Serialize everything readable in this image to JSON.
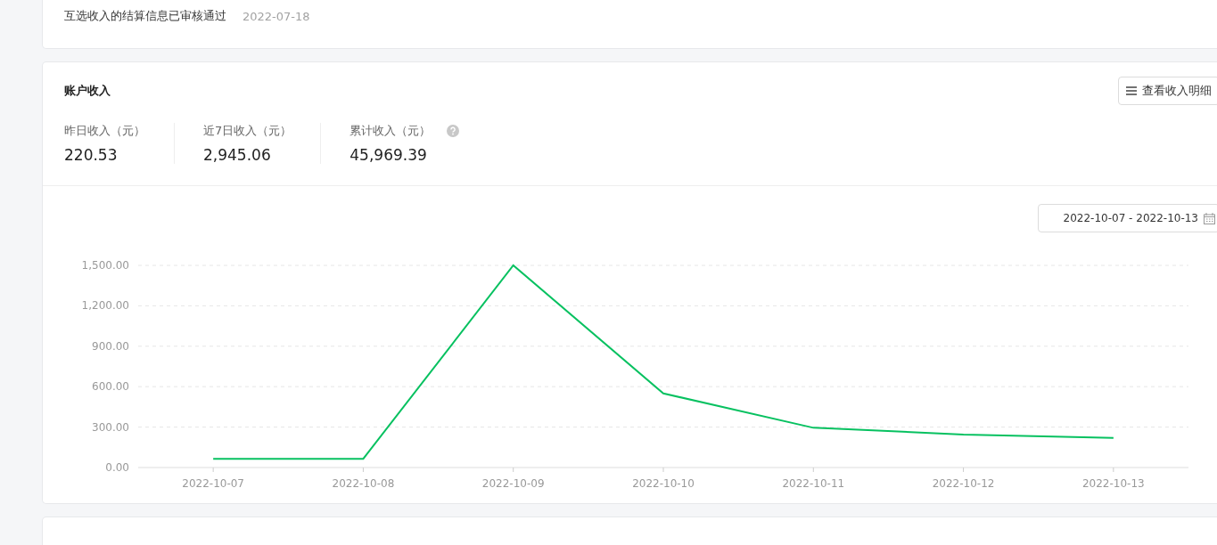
{
  "notices": [
    {
      "text": "互选收入的结算信息已审核通过",
      "date": "2022-07-18"
    }
  ],
  "income": {
    "title": "账户收入",
    "detail_button": "查看收入明细",
    "stats": [
      {
        "label": "昨日收入（元）",
        "value": "220.53",
        "help": false
      },
      {
        "label": "近7日收入（元）",
        "value": "2,945.06",
        "help": false
      },
      {
        "label": "累计收入（元）",
        "value": "45,969.39",
        "help": true
      }
    ],
    "date_range": "2022-10-07 - 2022-10-13",
    "chart_data": {
      "type": "line",
      "categories": [
        "2022-10-07",
        "2022-10-08",
        "2022-10-09",
        "2022-10-10",
        "2022-10-11",
        "2022-10-12",
        "2022-10-13"
      ],
      "series": [
        {
          "color": "#07c160",
          "values": [
            65,
            65,
            1500,
            550,
            295,
            245,
            220
          ]
        }
      ],
      "grid": true,
      "ylim": [
        0,
        1500
      ],
      "yticks": [
        {
          "value": 0,
          "label": "0.00"
        },
        {
          "value": 300,
          "label": "300.00"
        },
        {
          "value": 600,
          "label": "600.00"
        },
        {
          "value": 900,
          "label": "900.00"
        },
        {
          "value": 1200,
          "label": "1,200.00"
        },
        {
          "value": 1500,
          "label": "1,500.00"
        }
      ]
    }
  }
}
